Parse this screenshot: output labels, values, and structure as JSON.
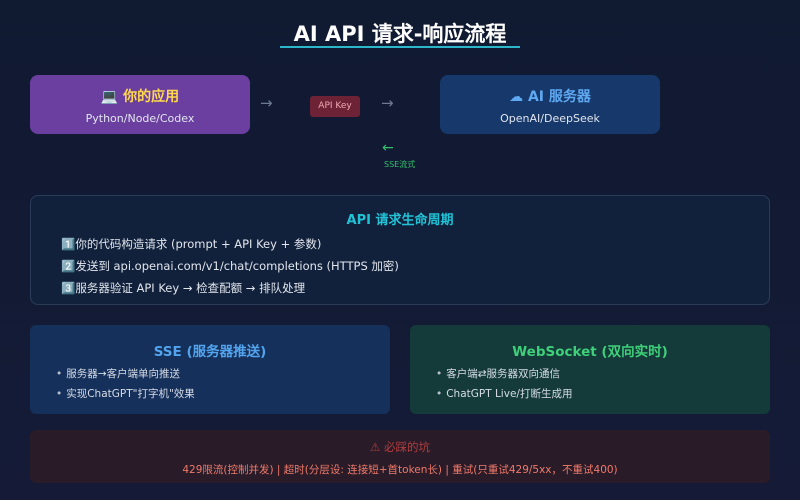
{
  "title": "AI API 请求-响应流程",
  "colors": {
    "accent_cyan": "#22c2d6",
    "app_box": "#6a3f9f",
    "ai_box": "#16386a",
    "sse_green": "#31c16b",
    "warning_red": "#f07a6a"
  },
  "client": {
    "icon": "💻",
    "icon_name": "laptop-icon",
    "name": "你的应用",
    "subtitle": "Python/Node/Codex"
  },
  "server": {
    "icon": "☁",
    "icon_name": "cloud-icon",
    "name": "AI 服务器",
    "subtitle": "OpenAI/DeepSeek"
  },
  "flow": {
    "arrow_right": "→",
    "request_badge": "API Key",
    "arrow_back": "←",
    "response_label": "SSE流式"
  },
  "lifecycle": {
    "title": "API 请求生命周期",
    "steps": [
      "1️⃣你的代码构造请求 (prompt + API Key + 参数)",
      "2️⃣发送到 api.openai.com/v1/chat/completions (HTTPS 加密)",
      "3️⃣服务器验证 API Key → 检查配额 → 排队处理"
    ]
  },
  "sse": {
    "title": "SSE (服务器推送)",
    "items": [
      "服务器→客户端单向推送",
      "实现ChatGPT\"打字机\"效果"
    ]
  },
  "websocket": {
    "title": "WebSocket (双向实时)",
    "items": [
      "客户端⇄服务器双向通信",
      "ChatGPT Live/打断生成用"
    ]
  },
  "pitfalls": {
    "icon": "⚠",
    "icon_name": "warning-icon",
    "title": "必踩的坑",
    "text": "429限流(控制并发) | 超时(分层设: 连接短+首token长) | 重试(只重试429/5xx，不重试400)"
  }
}
